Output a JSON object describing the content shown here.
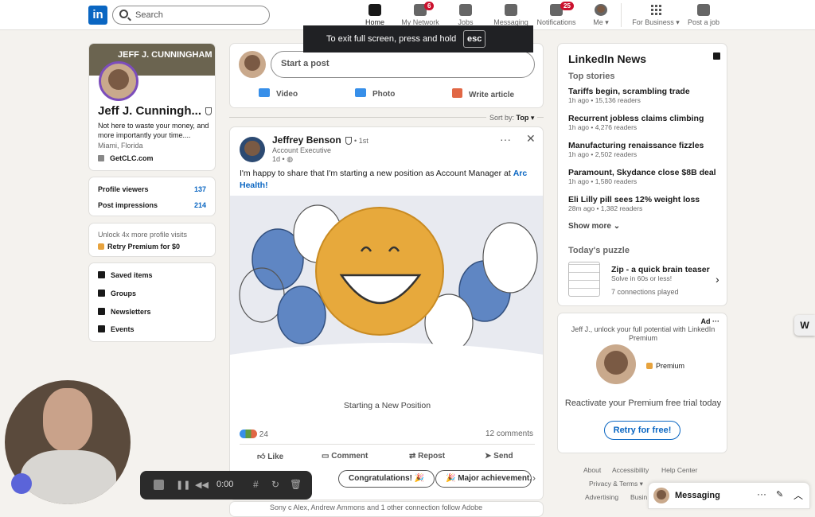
{
  "nav": {
    "search_placeholder": "Search",
    "items": [
      {
        "label": "Home",
        "badge": ""
      },
      {
        "label": "My Network",
        "badge": "6"
      },
      {
        "label": "Jobs",
        "badge": ""
      },
      {
        "label": "Messaging",
        "badge": ""
      },
      {
        "label": "Notifications",
        "badge": "25"
      },
      {
        "label": "Me",
        "badge": ""
      }
    ],
    "for_business": "For Business",
    "post_job": "Post a job"
  },
  "toast": {
    "text": "To exit full screen, press and hold",
    "key": "esc"
  },
  "profile": {
    "banner_text": "JEFF J. CUNNINGHAM",
    "name": "Jeff J. Cunningh...",
    "headline": "Not here to waste your money, and more importantly your time....",
    "location": "Miami, Florida",
    "website": "GetCLC.com",
    "stats": [
      {
        "label": "Profile viewers",
        "value": "137"
      },
      {
        "label": "Post impressions",
        "value": "214"
      }
    ],
    "premium_prompt": "Unlock 4x more profile visits",
    "premium_cta": "Retry Premium for $0",
    "links": [
      "Saved items",
      "Groups",
      "Newsletters",
      "Events"
    ]
  },
  "composer": {
    "placeholder": "Start a post",
    "actions": [
      "Video",
      "Photo",
      "Write article"
    ]
  },
  "sort": {
    "label": "Sort by:",
    "value": "Top"
  },
  "post": {
    "author": "Jeffrey Benson",
    "degree": "• 1st",
    "title": "Account Executive",
    "time": "1d •",
    "text": "I'm happy to share that I'm starting a new position as Account Manager at",
    "company": "Arc Health!",
    "image_caption": "Starting a New Position",
    "reactions": "24",
    "comments": "12 comments",
    "actions": [
      "Like",
      "Comment",
      "Repost",
      "Send"
    ],
    "suggestions": [
      "Congratulations! 🎉",
      "🎉 Major achievement,"
    ],
    "next_preview": "Sony c Alex, Andrew Ammons and 1 other connection follow Adobe"
  },
  "news": {
    "title": "LinkedIn News",
    "subtitle": "Top stories",
    "items": [
      {
        "headline": "Tariffs begin, scrambling trade",
        "meta": "1h ago • 15,136 readers"
      },
      {
        "headline": "Recurrent jobless claims climbing",
        "meta": "1h ago • 4,276 readers"
      },
      {
        "headline": "Manufacturing renaissance fizzles",
        "meta": "1h ago • 2,502 readers"
      },
      {
        "headline": "Paramount, Skydance close $8B deal",
        "meta": "1h ago • 1,580 readers"
      },
      {
        "headline": "Eli Lilly pill sees 12% weight loss",
        "meta": "28m ago • 1,382 readers"
      }
    ],
    "show_more": "Show more",
    "puzzle_title": "Today's puzzle",
    "puzzle_name": "Zip - a quick brain teaser",
    "puzzle_desc": "Solve in 60s or less!",
    "puzzle_played": "7 connections played"
  },
  "ad": {
    "label": "Ad",
    "text": "Jeff J., unlock your full potential with LinkedIn Premium",
    "premium": "Premium",
    "headline": "Reactivate your Premium free trial today",
    "cta": "Retry for free!"
  },
  "footer": [
    "About",
    "Accessibility",
    "Help Center",
    "Privacy & Terms",
    "Advertising",
    "Busin"
  ],
  "messaging": {
    "label": "Messaging"
  },
  "recorder": {
    "time": "0:00"
  }
}
